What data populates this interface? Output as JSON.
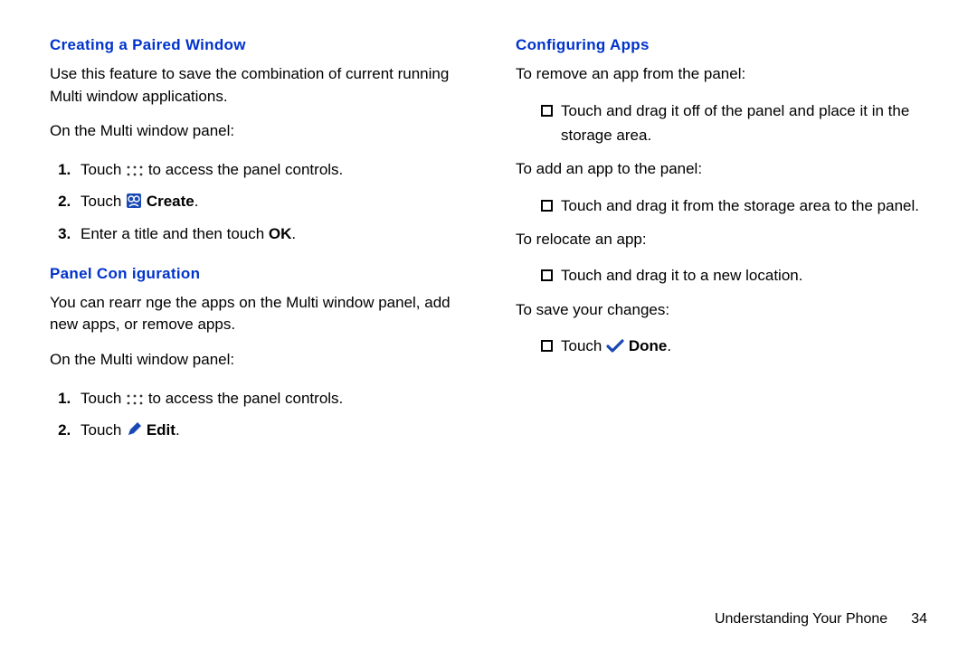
{
  "left": {
    "h1": "Creating a Paired Window",
    "p1": "Use this feature to save the combination of current running Multi window applications.",
    "p2": "On the Multi window panel:",
    "s1a": "Touch ",
    "s1b": " to access the panel controls.",
    "s2a": "Touch ",
    "s2b": "Create",
    "s2c": ".",
    "s3a": "Enter a title and then touch ",
    "s3b": "OK",
    "s3c": ".",
    "h2": "Panel Con  iguration",
    "p3": "You can rearr   nge the apps on the Multi window panel, add new apps, or remove apps.",
    "p4": "On the Multi window panel:",
    "s4a": "Touch ",
    "s4b": " to access the panel controls.",
    "s5a": "Touch ",
    "s5b": "Edit",
    "s5c": "."
  },
  "right": {
    "h1": "Configuring Apps",
    "p1": "To remove an app from the panel:",
    "b1": "Touch and drag it off of the panel and place it in the storage area.",
    "p2": "To add an app to the panel:",
    "b2": "Touch and drag it from the storage area to the panel.",
    "p3": "To relocate an app:",
    "b3": "Touch and drag it to a new location.",
    "p4": "To save your changes:",
    "b4a": "Touch ",
    "b4b": "Done",
    "b4c": "."
  },
  "footer": {
    "section": "Understanding Your Phone",
    "page": "34"
  }
}
